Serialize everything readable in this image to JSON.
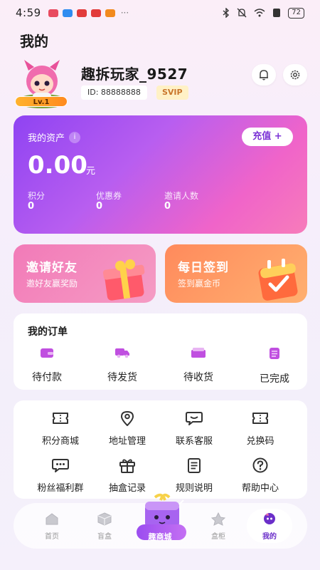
{
  "status_bar": {
    "time": "4:59",
    "battery": "72"
  },
  "page_title": "我的",
  "profile": {
    "username": "趣拆玩家_9527",
    "user_id": "ID: 88888888",
    "vip_badge": "SVIP",
    "level": "Lv.1"
  },
  "assets": {
    "title": "我的资产",
    "info_icon": "i",
    "recharge_label": "充值 +",
    "balance": "0.00",
    "balance_unit": "元",
    "stats": [
      {
        "label": "积分",
        "value": "0"
      },
      {
        "label": "优惠券",
        "value": "0"
      },
      {
        "label": "邀请人数",
        "value": "0"
      }
    ]
  },
  "promos": {
    "invite": {
      "title": "邀请好友",
      "subtitle": "邀好友赢奖励"
    },
    "signin": {
      "title": "每日签到",
      "subtitle": "签到赢金币"
    }
  },
  "orders": {
    "title": "我的订单",
    "items": [
      {
        "label": "待付款",
        "icon": "wallet-icon"
      },
      {
        "label": "待发货",
        "icon": "truck-icon"
      },
      {
        "label": "待收货",
        "icon": "package-icon"
      },
      {
        "label": "已完成",
        "icon": "checklist-icon"
      }
    ]
  },
  "services": [
    {
      "label": "积分商城",
      "icon": "ticket-icon"
    },
    {
      "label": "地址管理",
      "icon": "location-icon"
    },
    {
      "label": "联系客服",
      "icon": "chat-icon"
    },
    {
      "label": "兑换码",
      "icon": "ticket-icon"
    },
    {
      "label": "粉丝福利群",
      "icon": "group-chat-icon"
    },
    {
      "label": "抽盒记录",
      "icon": "gift-icon"
    },
    {
      "label": "规则说明",
      "icon": "document-icon"
    },
    {
      "label": "帮助中心",
      "icon": "help-icon"
    }
  ],
  "bottom_nav": [
    {
      "label": "首页"
    },
    {
      "label": "盲盒"
    },
    {
      "label": "趣商城"
    },
    {
      "label": "盒柜"
    },
    {
      "label": "我的"
    }
  ],
  "colors": {
    "accent": "#9b4df0",
    "brand_pink": "#f064c9",
    "icon_purple": "#c04fe0"
  }
}
